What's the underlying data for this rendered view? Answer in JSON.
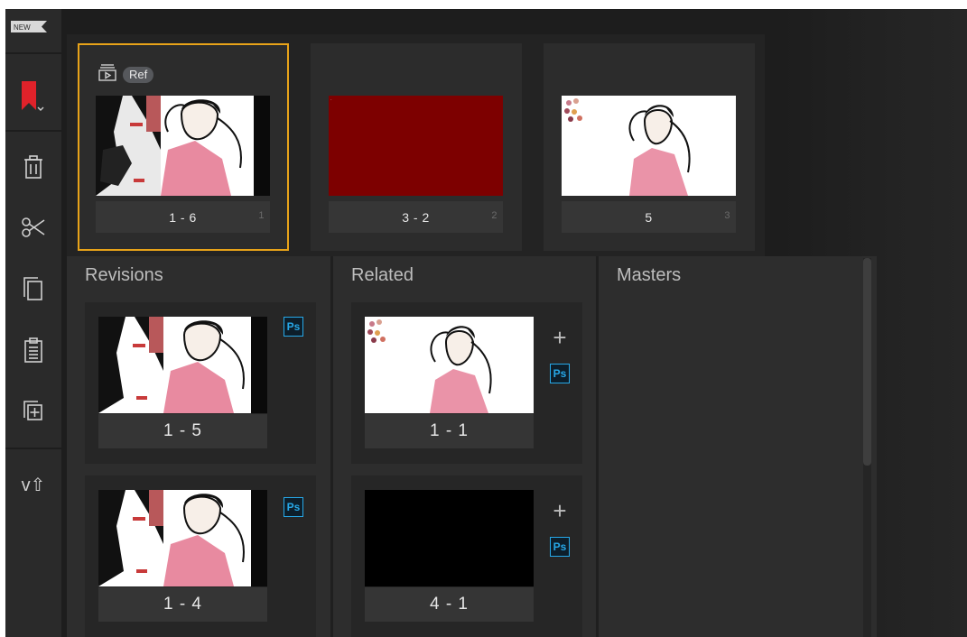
{
  "toolbar": {
    "new_badge": "NEW",
    "items": [
      {
        "icon": "bookmark-icon"
      },
      {
        "icon": "trash-icon"
      },
      {
        "icon": "scissors-icon"
      },
      {
        "icon": "copy-icon"
      },
      {
        "icon": "clipboard-icon"
      },
      {
        "icon": "duplicate-add-icon"
      },
      {
        "icon": "version-up-icon",
        "label": "v⇧"
      }
    ]
  },
  "strip": {
    "cards": [
      {
        "label": "1 - 6",
        "index": "1",
        "selected": true,
        "ref_badge": "Ref",
        "thumb": "art-pair"
      },
      {
        "label": "3 - 2",
        "index": "2",
        "selected": false,
        "thumb": "red"
      },
      {
        "label": "5",
        "index": "3",
        "selected": false,
        "thumb": "art-white"
      }
    ]
  },
  "panels": {
    "revisions": {
      "title": "Revisions",
      "items": [
        {
          "label": "1 - 5",
          "ps": "Ps"
        },
        {
          "label": "1 - 4",
          "ps": "Ps"
        }
      ]
    },
    "related": {
      "title": "Related",
      "items": [
        {
          "label": "1 - 1",
          "ps": "Ps",
          "add": "+"
        },
        {
          "label": "4 - 1",
          "ps": "Ps",
          "add": "+"
        }
      ]
    },
    "masters": {
      "title": "Masters"
    }
  },
  "colors": {
    "selection": "#e8a319",
    "photoshop": "#27a8e8",
    "bookmark": "#e0222a",
    "red_clip": "#7d0000"
  }
}
